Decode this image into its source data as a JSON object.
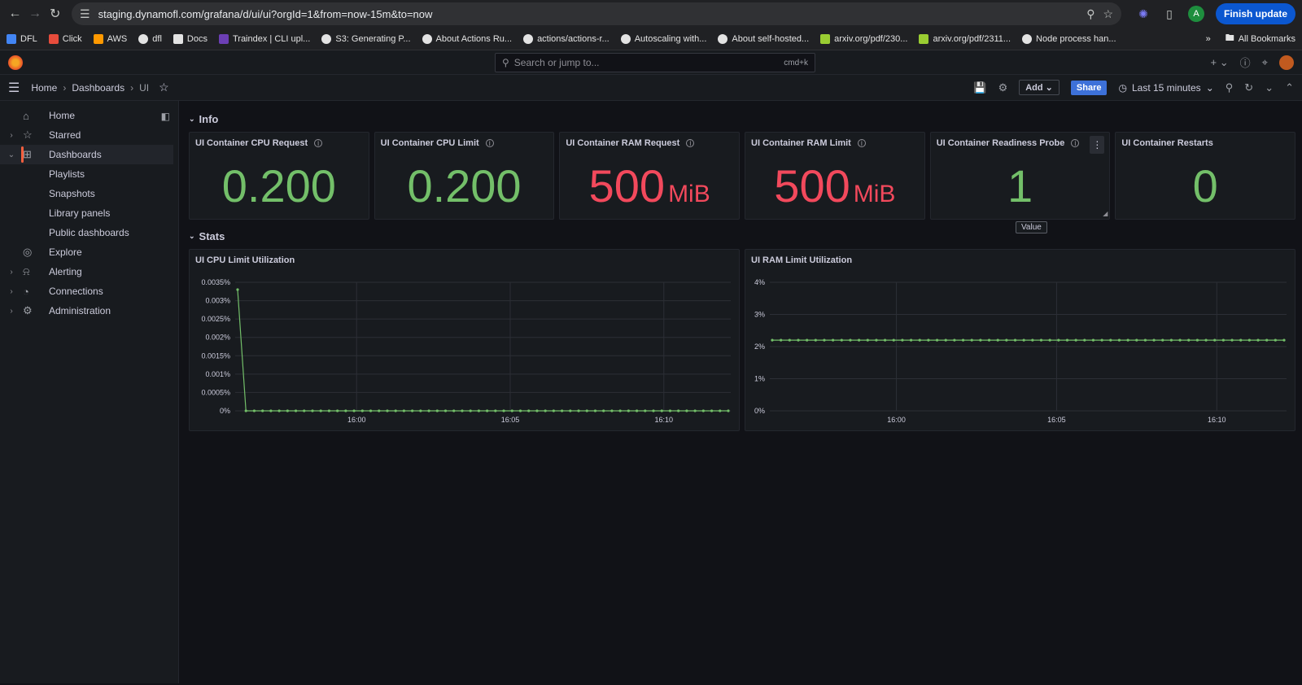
{
  "browser": {
    "url": "staging.dynamofl.com/grafana/d/ui/ui?orgId=1&from=now-15m&to=now",
    "profile_initial": "A",
    "finish_update": "Finish update"
  },
  "bookmarks": {
    "items": [
      {
        "label": "DFL",
        "icon": "dfl-icon",
        "color": "#4285f4"
      },
      {
        "label": "Click",
        "icon": "click-icon",
        "color": "#e74c3c"
      },
      {
        "label": "AWS",
        "icon": "aws-icon",
        "color": "#ff9900"
      },
      {
        "label": "dfl",
        "icon": "github-icon",
        "color": "#e3e3e3"
      },
      {
        "label": "Docs",
        "icon": "notion-icon",
        "color": "#e3e3e3"
      },
      {
        "label": "Traindex | CLI upl...",
        "icon": "traindex-icon",
        "color": "#6c3fb5"
      },
      {
        "label": "S3: Generating P...",
        "icon": "github-icon",
        "color": "#e3e3e3"
      },
      {
        "label": "About Actions Ru...",
        "icon": "github-icon",
        "color": "#e3e3e3"
      },
      {
        "label": "actions/actions-r...",
        "icon": "github-icon",
        "color": "#e3e3e3"
      },
      {
        "label": "Autoscaling with...",
        "icon": "github-icon",
        "color": "#e3e3e3"
      },
      {
        "label": "About self-hosted...",
        "icon": "github-icon",
        "color": "#e3e3e3"
      },
      {
        "label": "arxiv.org/pdf/230...",
        "icon": "arxiv-icon",
        "color": "#9acd32"
      },
      {
        "label": "arxiv.org/pdf/2311...",
        "icon": "arxiv-icon",
        "color": "#9acd32"
      },
      {
        "label": "Node process han...",
        "icon": "github-icon",
        "color": "#e3e3e3"
      }
    ],
    "all_bookmarks": "All Bookmarks"
  },
  "grafana": {
    "search_placeholder": "Search or jump to...",
    "search_shortcut": "cmd+k",
    "breadcrumb": [
      "Home",
      "Dashboards",
      "UI"
    ],
    "add_label": "Add",
    "share_label": "Share",
    "time_range": "Last 15 minutes"
  },
  "sidebar": {
    "items": [
      {
        "label": "Home",
        "icon": "home-icon",
        "caret": false,
        "sub": false,
        "active": false
      },
      {
        "label": "Starred",
        "icon": "star-icon",
        "caret": true,
        "sub": false,
        "active": false
      },
      {
        "label": "Dashboards",
        "icon": "dashboards-icon",
        "caret": true,
        "sub": false,
        "active": true
      },
      {
        "label": "Playlists",
        "icon": "",
        "caret": false,
        "sub": true,
        "active": false
      },
      {
        "label": "Snapshots",
        "icon": "",
        "caret": false,
        "sub": true,
        "active": false
      },
      {
        "label": "Library panels",
        "icon": "",
        "caret": false,
        "sub": true,
        "active": false
      },
      {
        "label": "Public dashboards",
        "icon": "",
        "caret": false,
        "sub": true,
        "active": false
      },
      {
        "label": "Explore",
        "icon": "compass-icon",
        "caret": false,
        "sub": false,
        "active": false
      },
      {
        "label": "Alerting",
        "icon": "bell-icon",
        "caret": true,
        "sub": false,
        "active": false
      },
      {
        "label": "Connections",
        "icon": "connections-icon",
        "caret": true,
        "sub": false,
        "active": false
      },
      {
        "label": "Administration",
        "icon": "gear-icon",
        "caret": true,
        "sub": false,
        "active": false
      }
    ]
  },
  "rows": {
    "info": "Info",
    "stats": "Stats"
  },
  "stats": [
    {
      "title": "UI Container CPU Request",
      "value": "0.200",
      "unit": "",
      "color": "#73bf69",
      "info": true
    },
    {
      "title": "UI Container CPU Limit",
      "value": "0.200",
      "unit": "",
      "color": "#73bf69",
      "info": true
    },
    {
      "title": "UI Container RAM Request",
      "value": "500",
      "unit": "MiB",
      "color": "#f2495c",
      "info": true
    },
    {
      "title": "UI Container RAM Limit",
      "value": "500",
      "unit": "MiB",
      "color": "#f2495c",
      "info": true
    },
    {
      "title": "UI Container Readiness Probe",
      "value": "1",
      "unit": "",
      "color": "#73bf69",
      "info": true
    },
    {
      "title": "UI Container Restarts",
      "value": "0",
      "unit": "",
      "color": "#73bf69",
      "info": false
    }
  ],
  "tooltip": "Value",
  "chart_data": [
    {
      "type": "line",
      "title": "UI CPU Limit Utilization",
      "y_ticks": [
        "0%",
        "0.0005%",
        "0.001%",
        "0.0015%",
        "0.002%",
        "0.0025%",
        "0.003%",
        "0.0035%"
      ],
      "ylim": [
        0,
        0.0035
      ],
      "x_ticks": [
        "16:00",
        "16:05",
        "16:10"
      ],
      "series": [
        {
          "color": "#73bf69",
          "values": [
            0.0033,
            0,
            0,
            0,
            0,
            0,
            0,
            0,
            0,
            0,
            0,
            0,
            0,
            0,
            0,
            0,
            0,
            0,
            0,
            0,
            0,
            0,
            0,
            0,
            0,
            0,
            0,
            0,
            0,
            0,
            0,
            0,
            0,
            0,
            0,
            0,
            0,
            0,
            0,
            0,
            0,
            0,
            0,
            0,
            0,
            0,
            0,
            0,
            0,
            0,
            0,
            0,
            0,
            0,
            0,
            0,
            0,
            0,
            0,
            0
          ]
        }
      ]
    },
    {
      "type": "line",
      "title": "UI RAM Limit Utilization",
      "y_ticks": [
        "0%",
        "1%",
        "2%",
        "3%",
        "4%"
      ],
      "ylim": [
        0,
        4
      ],
      "x_ticks": [
        "16:00",
        "16:05",
        "16:10"
      ],
      "series": [
        {
          "color": "#73bf69",
          "values": [
            2.2,
            2.2,
            2.2,
            2.2,
            2.2,
            2.2,
            2.2,
            2.2,
            2.2,
            2.2,
            2.2,
            2.2,
            2.2,
            2.2,
            2.2,
            2.2,
            2.2,
            2.2,
            2.2,
            2.2,
            2.2,
            2.2,
            2.2,
            2.2,
            2.2,
            2.2,
            2.2,
            2.2,
            2.2,
            2.2,
            2.2,
            2.2,
            2.2,
            2.2,
            2.2,
            2.2,
            2.2,
            2.2,
            2.2,
            2.2,
            2.2,
            2.2,
            2.2,
            2.2,
            2.2,
            2.2,
            2.2,
            2.2,
            2.2,
            2.2,
            2.2,
            2.2,
            2.2,
            2.2,
            2.2,
            2.2,
            2.2,
            2.2,
            2.2,
            2.2
          ]
        }
      ]
    }
  ]
}
